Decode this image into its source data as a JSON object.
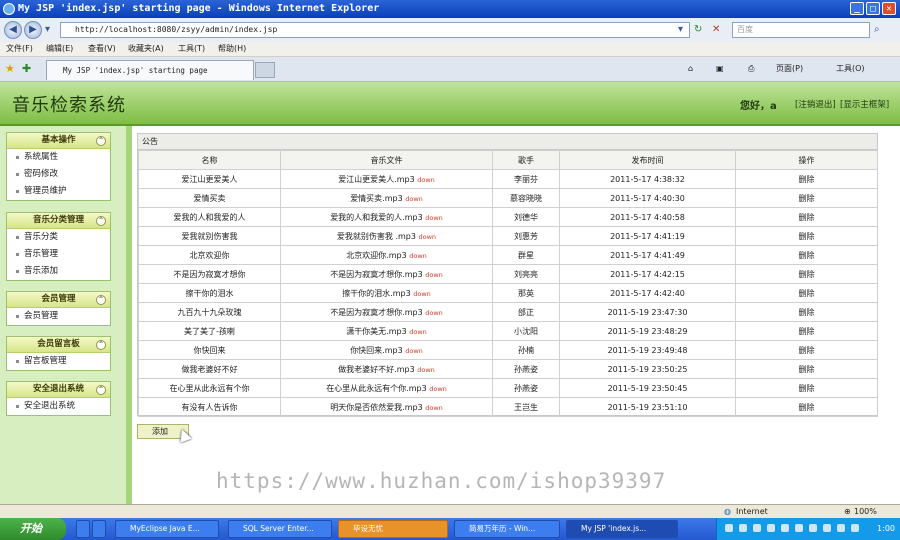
{
  "window": {
    "title": "My JSP 'index.jsp' starting page - Windows Internet Explorer",
    "minimize": "_",
    "maximize": "□",
    "close": "✕"
  },
  "address_bar": {
    "url": "http://localhost:8080/zsyy/admin/index.jsp",
    "search_placeholder": "百度"
  },
  "menu": [
    "文件(F)",
    "编辑(E)",
    "查看(V)",
    "收藏夹(A)",
    "工具(T)",
    "帮助(H)"
  ],
  "tabs": {
    "active_label": "My JSP 'index.jsp' starting page",
    "commands": {
      "page": "页面(P)",
      "tools": "工具(O)"
    }
  },
  "app": {
    "title": "音乐检索系统",
    "greeting": "您好，a",
    "logout": "[注销退出]",
    "show_frame": "[显示主框架]"
  },
  "sidebar": [
    {
      "title": "基本操作",
      "items": [
        "系统属性",
        "密码修改",
        "管理员维护"
      ]
    },
    {
      "title": "音乐分类管理",
      "items": [
        "音乐分类",
        "音乐管理",
        "音乐添加"
      ]
    },
    {
      "title": "会员管理",
      "items": [
        "会员管理"
      ]
    },
    {
      "title": "会员留言板",
      "items": [
        "留言板管理"
      ]
    },
    {
      "title": "安全退出系统",
      "items": [
        "安全退出系统"
      ]
    }
  ],
  "main": {
    "panel_title": "公告",
    "columns": [
      "名称",
      "音乐文件",
      "歌手",
      "发布时间",
      "操作"
    ],
    "down_label": "down",
    "rows": [
      {
        "name": "爱江山更爱美人",
        "file": "爱江山更爱美人.mp3",
        "singer": "李丽芬",
        "time": "2011-5-17 4:38:32",
        "action": "删除"
      },
      {
        "name": "爱情买卖",
        "file": "爱情买卖.mp3",
        "singer": "慕容晓晓",
        "time": "2011-5-17 4:40:30",
        "action": "删除"
      },
      {
        "name": "爱我的人和我爱的人",
        "file": "爱我的人和我爱的人.mp3",
        "singer": "刘德华",
        "time": "2011-5-17 4:40:58",
        "action": "删除"
      },
      {
        "name": "爱我就别伤害我",
        "file": "爱我就别伤害我 .mp3",
        "singer": "刘惠芳",
        "time": "2011-5-17 4:41:19",
        "action": "删除"
      },
      {
        "name": "北京欢迎你",
        "file": "北京欢迎你.mp3",
        "singer": "群星",
        "time": "2011-5-17 4:41:49",
        "action": "删除"
      },
      {
        "name": "不是因为寂寞才想你",
        "file": "不是因为寂寞才想你.mp3",
        "singer": "刘亮亮",
        "time": "2011-5-17 4:42:15",
        "action": "删除"
      },
      {
        "name": "擦干你的泪水",
        "file": "擦干你的泪水.mp3",
        "singer": "那英",
        "time": "2011-5-17 4:42:40",
        "action": "删除"
      },
      {
        "name": "九百九十九朵玫瑰",
        "file": "不是因为寂寞才想你.mp3",
        "singer": "邰正",
        "time": "2011-5-19 23:47:30",
        "action": "删除"
      },
      {
        "name": "美了美了-孩喇",
        "file": "潇干你美无.mp3",
        "singer": "小沈阳",
        "time": "2011-5-19 23:48:29",
        "action": "删除"
      },
      {
        "name": "你快回来",
        "file": "你快回来.mp3",
        "singer": "孙楠",
        "time": "2011-5-19 23:49:48",
        "action": "删除"
      },
      {
        "name": "做我老婆好不好",
        "file": "做我老婆好不好.mp3",
        "singer": "孙燕姿",
        "time": "2011-5-19 23:50:25",
        "action": "删除"
      },
      {
        "name": "在心里从此永远有个你",
        "file": "在心里从此永远有个你.mp3",
        "singer": "孙燕姿",
        "time": "2011-5-19 23:50:45",
        "action": "删除"
      },
      {
        "name": "有没有人告诉你",
        "file": "明天你是否依然爱我.mp3",
        "singer": "王岂生",
        "time": "2011-5-19 23:51:10",
        "action": "删除"
      }
    ],
    "add_button": "添加"
  },
  "watermark": "https://www.huzhan.com/ishop39397",
  "statusbar": {
    "zone": "Internet",
    "zoom": "100%"
  },
  "taskbar": {
    "start": "开始",
    "buttons": [
      "MyEclipse Java E...",
      "SQL Server Enter...",
      "毕设无忧",
      "简易万年历 - Win...",
      "My JSP 'index.js..."
    ],
    "clock": "1:00"
  }
}
